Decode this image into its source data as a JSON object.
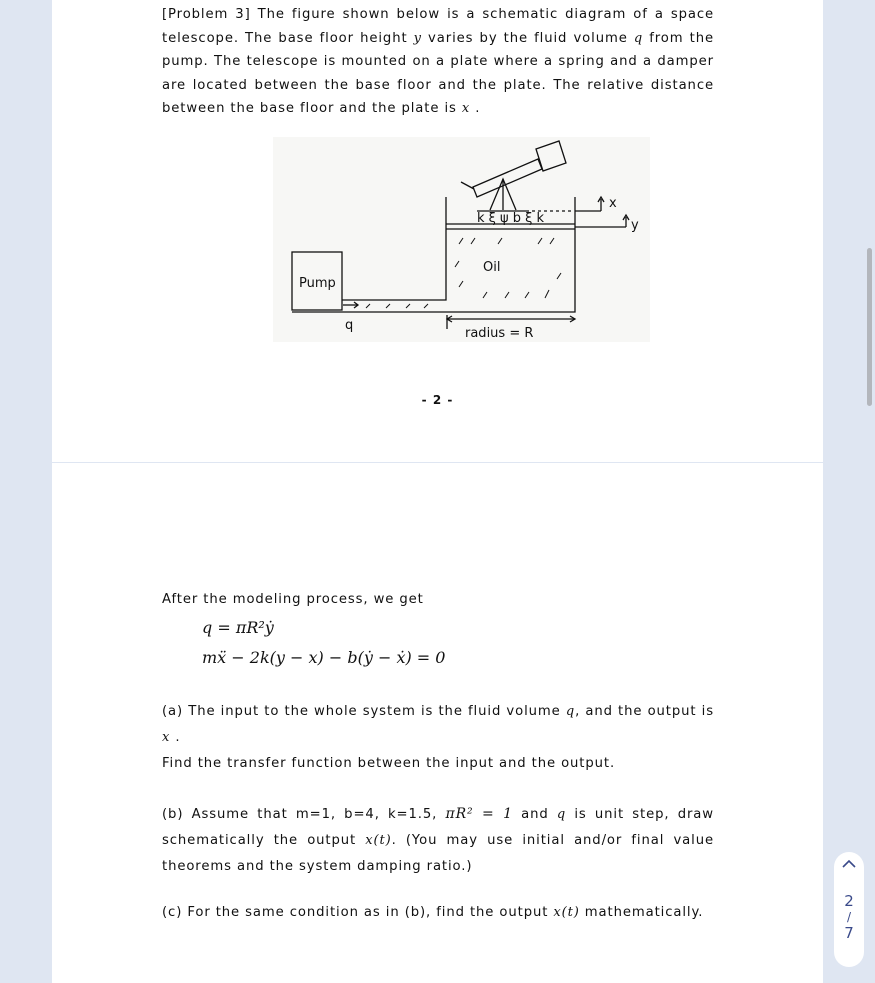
{
  "problem": {
    "heading": "[Problem 3]",
    "intro_1": " The figure shown below is a schematic diagram of a space telescope. The base floor height ",
    "var_y": "y",
    "intro_2": " varies by the fluid volume ",
    "var_q": "q",
    "intro_3": " from the pump. The telescope is mounted on a plate where a spring and a damper are located between the base floor and the plate. The relative distance between the base floor and the plate is ",
    "var_x": "x",
    "intro_4": " ."
  },
  "diagram": {
    "pump": "Pump",
    "oil": "Oil",
    "flow": "q",
    "x": "x",
    "y": "y",
    "radius": "radius = R",
    "components": "k ξ ψ b ξ k"
  },
  "page_number": "- 2 -",
  "modeling": {
    "intro": "After the modeling process, we get",
    "eq1": "q = πR²ẏ",
    "eq2": "mẍ − 2k(y − x) − b(ẏ − ẋ) = 0"
  },
  "part_a": {
    "t1": "(a) The input to the whole system is the fluid volume ",
    "q": "q",
    "t2": ", and the output is ",
    "x": "x",
    "t3": " .",
    "line2": "Find the transfer function between the input and the output."
  },
  "part_b": {
    "t1": "(b) Assume that m=1, b=4, k=1.5, ",
    "cond": "πR² = 1",
    "t2": " and ",
    "q": "q",
    "t3": " is unit step, draw schematically the output ",
    "xt": "x(t)",
    "t4": ". (You may use initial and/or final value theorems and the system damping ratio.)"
  },
  "part_c": {
    "t1": "(c) For the same condition as in (b), find the output ",
    "xt": "x(t)",
    "t2": " mathematically."
  },
  "nav": {
    "up_icon": "chevron-up",
    "current": "2",
    "sep": "/",
    "total": "7"
  }
}
